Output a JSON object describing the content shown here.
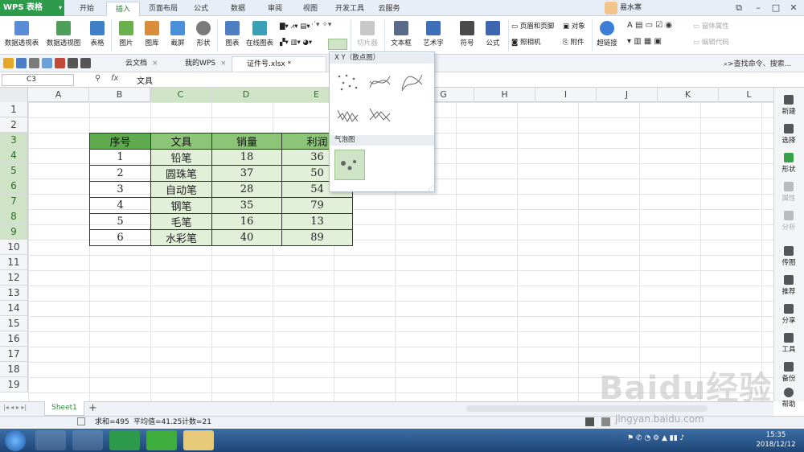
{
  "app": {
    "name": "WPS 表格"
  },
  "ribbon_tabs": [
    "开始",
    "插入",
    "页面布局",
    "公式",
    "数据",
    "审阅",
    "视图",
    "开发工具",
    "云服务"
  ],
  "user": {
    "name": "易水寒"
  },
  "ribbon": {
    "pivot_table": "数据透视表",
    "pivot_chart": "数据透视图",
    "table": "表格",
    "picture": "图片",
    "gallery": "图库",
    "screenshot": "截屏",
    "shapes": "形状",
    "chart": "图表",
    "online_chart": "在线图表",
    "slicer": "切片器",
    "textbox": "文本框",
    "art_text": "艺术字",
    "symbol": "符号",
    "formula": "公式",
    "header_footer": "页眉和页脚",
    "camera": "照相机",
    "object": "对象",
    "attachment": "附件",
    "hyperlink": "超链接",
    "form_props": "窗体属性",
    "edit_code": "编辑代码"
  },
  "doc_tabs": [
    "云文档",
    "我的WPS",
    "证件号.xlsx *"
  ],
  "search": {
    "placeholder": ">查找命令、搜索..."
  },
  "formula_bar": {
    "cell": "C3",
    "fx": "fx",
    "value": "文具"
  },
  "columns": [
    "A",
    "B",
    "C",
    "D",
    "E",
    "F",
    "G",
    "H",
    "I",
    "J",
    "K",
    "L"
  ],
  "rows": [
    "1",
    "2",
    "3",
    "4",
    "5",
    "6",
    "7",
    "8",
    "9",
    "10",
    "11",
    "12",
    "13",
    "14",
    "15",
    "16",
    "17",
    "18",
    "19"
  ],
  "table": {
    "headers": [
      "序号",
      "文具",
      "销量",
      "利润"
    ],
    "rows": [
      [
        "1",
        "铅笔",
        "18",
        "36"
      ],
      [
        "2",
        "圆珠笔",
        "37",
        "50"
      ],
      [
        "3",
        "自动笔",
        "28",
        "54"
      ],
      [
        "4",
        "钢笔",
        "35",
        "79"
      ],
      [
        "5",
        "毛笔",
        "16",
        "13"
      ],
      [
        "6",
        "水彩笔",
        "40",
        "89"
      ]
    ]
  },
  "dropdown": {
    "xy_title": "X Y（散点图）",
    "bubble_title": "气泡图"
  },
  "side_panel": [
    "新建",
    "选择",
    "形状",
    "属性",
    "分析",
    "传图",
    "推荐",
    "分享",
    "工具",
    "备份",
    "帮助"
  ],
  "sheet": {
    "tab": "Sheet1",
    "add": "+"
  },
  "status": {
    "sum": "求和=495",
    "avg": "平均值=41.25",
    "count": "计数=21"
  },
  "clock": {
    "time": "15:35",
    "date": "2018/12/12"
  },
  "watermark": {
    "main": "Baidu经验",
    "url": "jingyan.baidu.com"
  },
  "colors": {
    "accent": "#2e9a4b",
    "header_fill": "#5faa4f",
    "selection": "#cfe3c6"
  }
}
